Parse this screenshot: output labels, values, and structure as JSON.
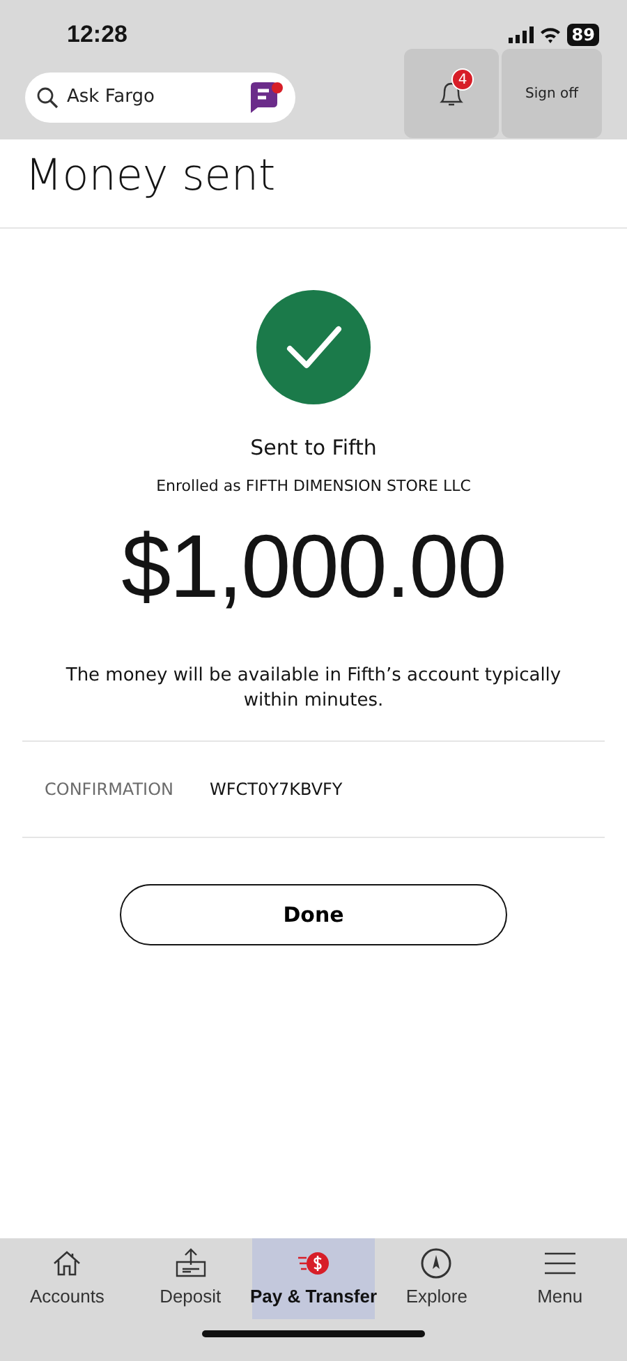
{
  "status_bar": {
    "time": "12:28",
    "battery": "89"
  },
  "header": {
    "search": {
      "placeholder": "Ask Fargo"
    },
    "notifications": {
      "count": "4"
    },
    "sign_off": "Sign off"
  },
  "title": "Money sent",
  "receipt": {
    "recipient": "Sent to Fifth",
    "enrolled": "Enrolled as FIFTH DIMENSION STORE LLC",
    "amount": "$1,000.00",
    "message": "The money will be available in Fifth’s account typically within minutes.",
    "confirmation": {
      "label": "CONFIRMATION",
      "value": "WFCT0Y7KBVFY"
    },
    "done": "Done"
  },
  "tabs": [
    {
      "kind": "accounts",
      "label": "Accounts",
      "selected": false
    },
    {
      "kind": "deposit",
      "label": "Deposit",
      "selected": false
    },
    {
      "kind": "pay",
      "label": "Pay & Transfer",
      "selected": true
    },
    {
      "kind": "explore",
      "label": "Explore",
      "selected": false
    },
    {
      "kind": "menu",
      "label": "Menu",
      "selected": false
    }
  ]
}
